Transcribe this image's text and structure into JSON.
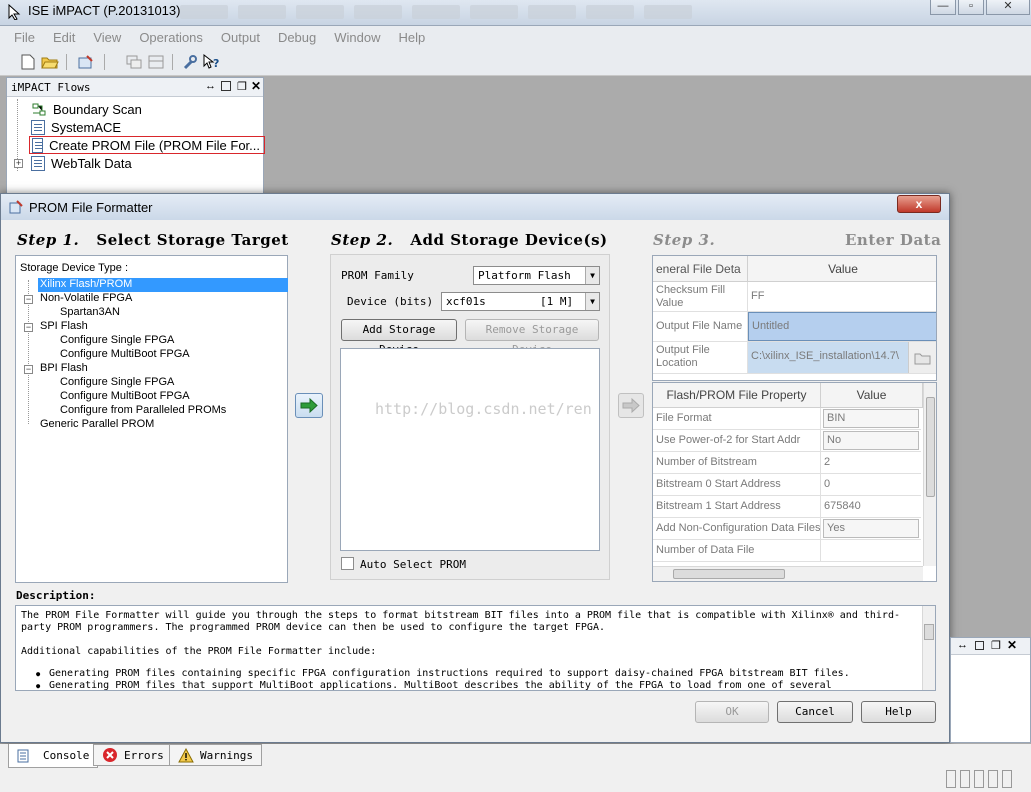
{
  "app": {
    "title": "ISE iMPACT (P.20131013)"
  },
  "window_controls": {
    "minimize": "—",
    "restore": "▫",
    "close": "✕"
  },
  "menu": [
    "File",
    "Edit",
    "View",
    "Operations",
    "Output",
    "Debug",
    "Window",
    "Help"
  ],
  "toolbar": {
    "icons": [
      "new-icon",
      "open-icon",
      "wizard-icon",
      "cascade-icon",
      "tile-icon",
      "wrench-icon",
      "help-cursor-icon"
    ]
  },
  "flows": {
    "title": "iMPACT Flows",
    "items": [
      {
        "label": "Boundary Scan",
        "icon": "chain-icon"
      },
      {
        "label": "SystemACE",
        "icon": "document-icon"
      },
      {
        "label": "Create PROM File (PROM File For...",
        "icon": "document-icon",
        "selected": true
      },
      {
        "label": "WebTalk Data",
        "icon": "document-icon",
        "expander": "+"
      }
    ]
  },
  "dialog": {
    "title": "PROM File Formatter",
    "close": "x",
    "step1": {
      "step": "Step 1.",
      "label": "Select Storage Target"
    },
    "step2": {
      "step": "Step 2.",
      "label": "Add Storage Device(s)"
    },
    "step3": {
      "step": "Step 3.",
      "label": "Enter Data"
    },
    "tree": {
      "header": "Storage Device Type :",
      "nodes": [
        {
          "label": "Xilinx Flash/PROM",
          "level": 1,
          "selected": true
        },
        {
          "label": "Non-Volatile FPGA",
          "level": 1,
          "expander": "−"
        },
        {
          "label": "Spartan3AN",
          "level": 2
        },
        {
          "label": "SPI Flash",
          "level": 1,
          "expander": "−"
        },
        {
          "label": "Configure Single FPGA",
          "level": 2
        },
        {
          "label": "Configure MultiBoot FPGA",
          "level": 2
        },
        {
          "label": "BPI Flash",
          "level": 1,
          "expander": "−"
        },
        {
          "label": "Configure Single FPGA",
          "level": 2
        },
        {
          "label": "Configure MultiBoot FPGA",
          "level": 2
        },
        {
          "label": "Configure from Paralleled PROMs",
          "level": 2
        },
        {
          "label": "Generic Parallel PROM",
          "level": 1
        }
      ]
    },
    "prom_family_label": "PROM Family",
    "prom_family_value": "Platform Flash",
    "device_label": "Device (bits)",
    "device_value": "xcf01s",
    "device_size": "[1 M]",
    "add_device_btn": "Add Storage Device",
    "remove_device_btn": "Remove Storage Device",
    "auto_select_label": "Auto Select PROM",
    "general_table": {
      "col1": "eneral File Deta",
      "col2": "Value",
      "rows": [
        {
          "name": "Checksum Fill Value",
          "value": "FF"
        },
        {
          "name": "Output File Name",
          "value": "Untitled",
          "highlight": true
        },
        {
          "name": "Output File Location",
          "value": "C:\\xilinx_ISE_installation\\14.7\\"
        }
      ]
    },
    "prop_table": {
      "col1": "Flash/PROM File Property",
      "col2": "Value",
      "rows": [
        {
          "name": "File Format",
          "value": "BIN"
        },
        {
          "name": "Use Power-of-2 for Start Addr",
          "value": "No"
        },
        {
          "name": "Number of Bitstream",
          "value": "2"
        },
        {
          "name": "Bitstream 0 Start Address",
          "value": "0"
        },
        {
          "name": "Bitstream 1 Start Address",
          "value": "675840"
        },
        {
          "name": "Add Non-Configuration Data Files",
          "value": "Yes"
        },
        {
          "name": "Number of Data File",
          "value": ""
        }
      ]
    },
    "description_label": "Description:",
    "description": {
      "p1": "The PROM File Formatter will guide you through the steps to format bitstream BIT files into a PROM file that is compatible with Xilinx® and third-party PROM programmers. The programmed PROM device can then be used to configure the target FPGA.",
      "p2": "Additional capabilities of the PROM File Formatter include:",
      "b1": "Generating PROM files containing specific FPGA configuration instructions required to support daisy-chained FPGA bitstream BIT files.",
      "b2": "Generating PROM files that support MultiBoot applications. MultiBoot describes the ability of the FPGA to load from one of several"
    },
    "ok": "OK",
    "cancel": "Cancel",
    "help": "Help"
  },
  "watermark": "http://blog.csdn.net/ren",
  "bottom_tabs": [
    {
      "label": "Console",
      "icon": "console-icon"
    },
    {
      "label": "Errors",
      "icon": "error-icon"
    },
    {
      "label": "Warnings",
      "icon": "warning-icon"
    }
  ]
}
